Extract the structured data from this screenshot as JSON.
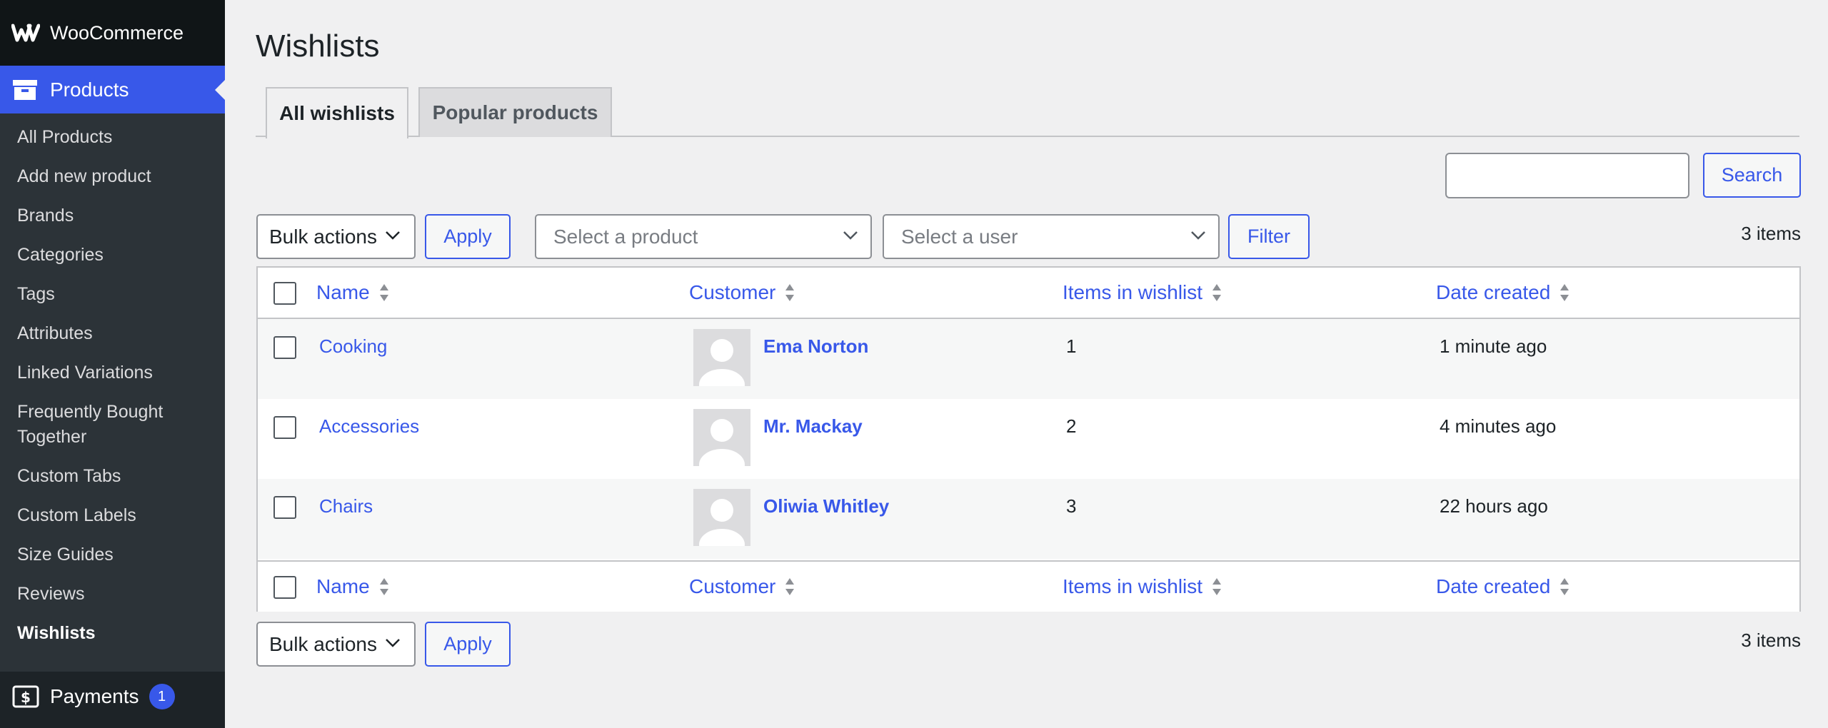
{
  "sidebar": {
    "brand": "WooCommerce",
    "section": "Products",
    "items": [
      "All Products",
      "Add new product",
      "Brands",
      "Categories",
      "Tags",
      "Attributes",
      "Linked Variations",
      "Frequently Bought Together",
      "Custom Tabs",
      "Custom Labels",
      "Size Guides",
      "Reviews",
      "Wishlists"
    ],
    "active_item": "Wishlists",
    "payments": {
      "label": "Payments",
      "badge": "1"
    }
  },
  "page": {
    "title": "Wishlists"
  },
  "tabs": [
    {
      "label": "All wishlists",
      "active": true
    },
    {
      "label": "Popular products",
      "active": false
    }
  ],
  "search": {
    "value": "",
    "button": "Search"
  },
  "toolbar": {
    "bulk_label": "Bulk actions",
    "apply_label": "Apply",
    "product_placeholder": "Select a product",
    "user_placeholder": "Select a user",
    "filter_label": "Filter",
    "count": "3 items"
  },
  "table": {
    "columns": [
      "Name",
      "Customer",
      "Items in wishlist",
      "Date created"
    ],
    "rows": [
      {
        "name": "Cooking",
        "customer": "Ema Norton",
        "items": "1",
        "date": "1 minute ago"
      },
      {
        "name": "Accessories",
        "customer": "Mr. Mackay",
        "items": "2",
        "date": "4 minutes ago"
      },
      {
        "name": "Chairs",
        "customer": "Oliwia Whitley",
        "items": "3",
        "date": "22 hours ago"
      }
    ]
  },
  "colors": {
    "accent": "#3858e9",
    "sidebar_bg": "#1d2327",
    "page_bg": "#f0f0f1"
  }
}
